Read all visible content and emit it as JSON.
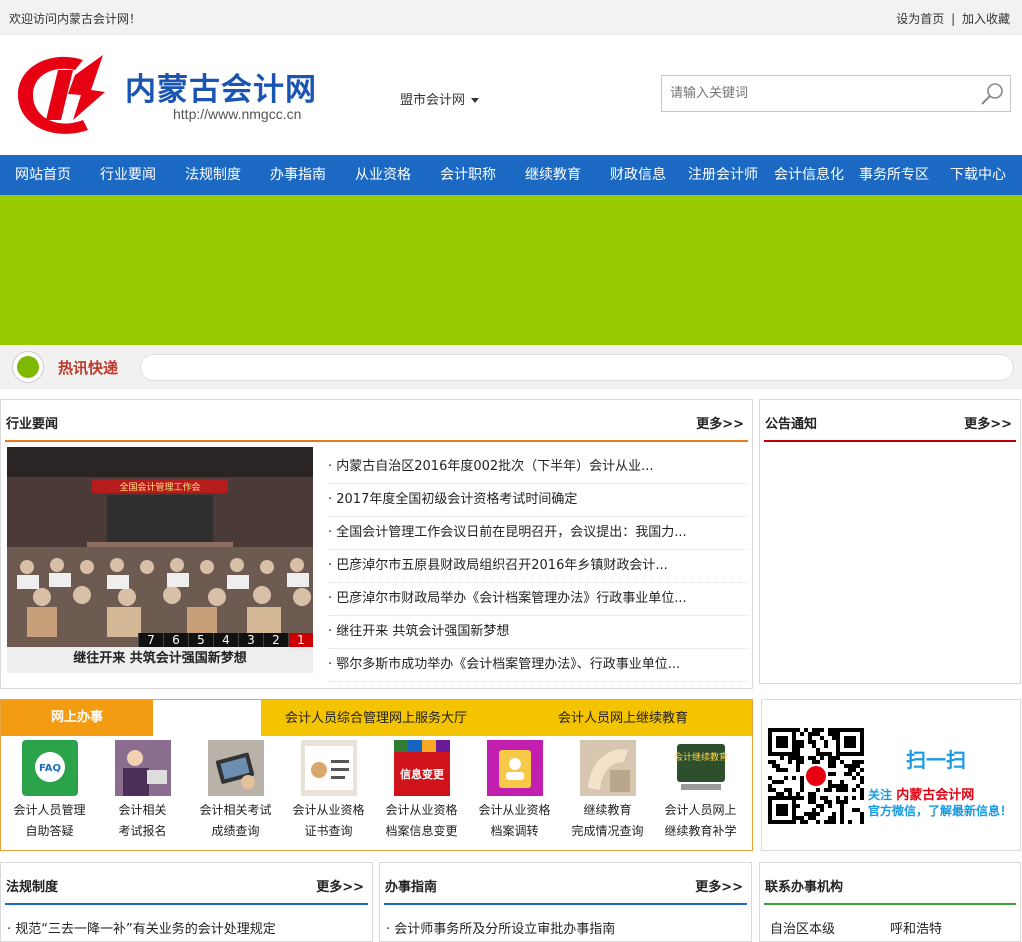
{
  "topbar": {
    "welcome": "欢迎访问内蒙古会计网！",
    "set_home": "设为首页",
    "separator": "|",
    "favorite": "加入收藏"
  },
  "logo": {
    "name": "内蒙古会计网",
    "url": "http://www.nmgcc.cn"
  },
  "city_selector": {
    "label": "盟市会计网"
  },
  "search": {
    "placeholder": "请输入关键词"
  },
  "nav": [
    "网站首页",
    "行业要闻",
    "法规制度",
    "办事指南",
    "从业资格",
    "会计职称",
    "继续教育",
    "财政信息",
    "注册会计师",
    "会计信息化",
    "事务所专区",
    "下载中心"
  ],
  "hot": {
    "title": "热讯快递"
  },
  "industry_news": {
    "title": "行业要闻",
    "more": "更多>>",
    "slide_caption": "继往开来 共筑会计强国新梦想",
    "slide_banner": "全国会计管理工作会",
    "pages": [
      "7",
      "6",
      "5",
      "4",
      "3",
      "2",
      "1"
    ],
    "items": [
      "· 内蒙古自治区2016年度002批次（下半年）会计从业...",
      "· 2017年度全国初级会计资格考试时间确定",
      "· 全国会计管理工作会议日前在昆明召开，会议提出：我国力...",
      "· 巴彦淖尔市五原县财政局组织召开2016年乡镇财政会计...",
      "· 巴彦淖尔市财政局举办《会计档案管理办法》行政事业单位...",
      "· 继往开来 共筑会计强国新梦想",
      "· 鄂尔多斯市成功举办《会计档案管理办法》、行政事业单位..."
    ]
  },
  "notice": {
    "title": "公告通知",
    "more": "更多>>"
  },
  "online": {
    "tab_main": "网上办事",
    "tab1": "会计人员综合管理网上服务大厅",
    "tab2": "会计人员网上继续教育",
    "services": [
      {
        "l1": "会计人员管理",
        "l2": "自助答疑",
        "icon": "faq-icon",
        "badge": "FAQ"
      },
      {
        "l1": "会计相关",
        "l2": "考试报名",
        "icon": "registration-photo-icon"
      },
      {
        "l1": "会计相关考试",
        "l2": "成绩查询",
        "icon": "score-query-photo-icon"
      },
      {
        "l1": "会计从业资格",
        "l2": "证书查询",
        "icon": "certificate-photo-icon"
      },
      {
        "l1": "会计从业资格",
        "l2": "档案信息变更",
        "icon": "info-change-icon",
        "badge": "信息变更"
      },
      {
        "l1": "会计从业资格",
        "l2": "档案调转",
        "icon": "file-transfer-icon"
      },
      {
        "l1": "继续教育",
        "l2": "完成情况查询",
        "icon": "education-status-photo-icon"
      },
      {
        "l1": "会计人员网上",
        "l2": "继续教育补学",
        "icon": "online-education-icon",
        "badge": "会计继续教育"
      }
    ]
  },
  "qr": {
    "scan": "扫一扫",
    "follow_prefix": "关注",
    "follow_name": "内蒙古会计网",
    "follow_suffix": "官方微信，了解最新信息！"
  },
  "regulations": {
    "title": "法规制度",
    "more": "更多>>",
    "first_item": "· 规范“三去一降一补”有关业务的会计处理规定"
  },
  "guide": {
    "title": "办事指南",
    "more": "更多>>",
    "first_item": "· 会计师事务所及分所设立审批办事指南"
  },
  "contact": {
    "title": "联系办事机构",
    "col1": "自治区本级",
    "col2": "呼和浩特"
  },
  "colors": {
    "nav_bg": "#1b69c3",
    "banner": "#99cc00",
    "accent_orange": "#e87722",
    "accent_red": "#c00000",
    "accent_blue": "#1b69c3",
    "accent_green": "#3aa03a"
  }
}
